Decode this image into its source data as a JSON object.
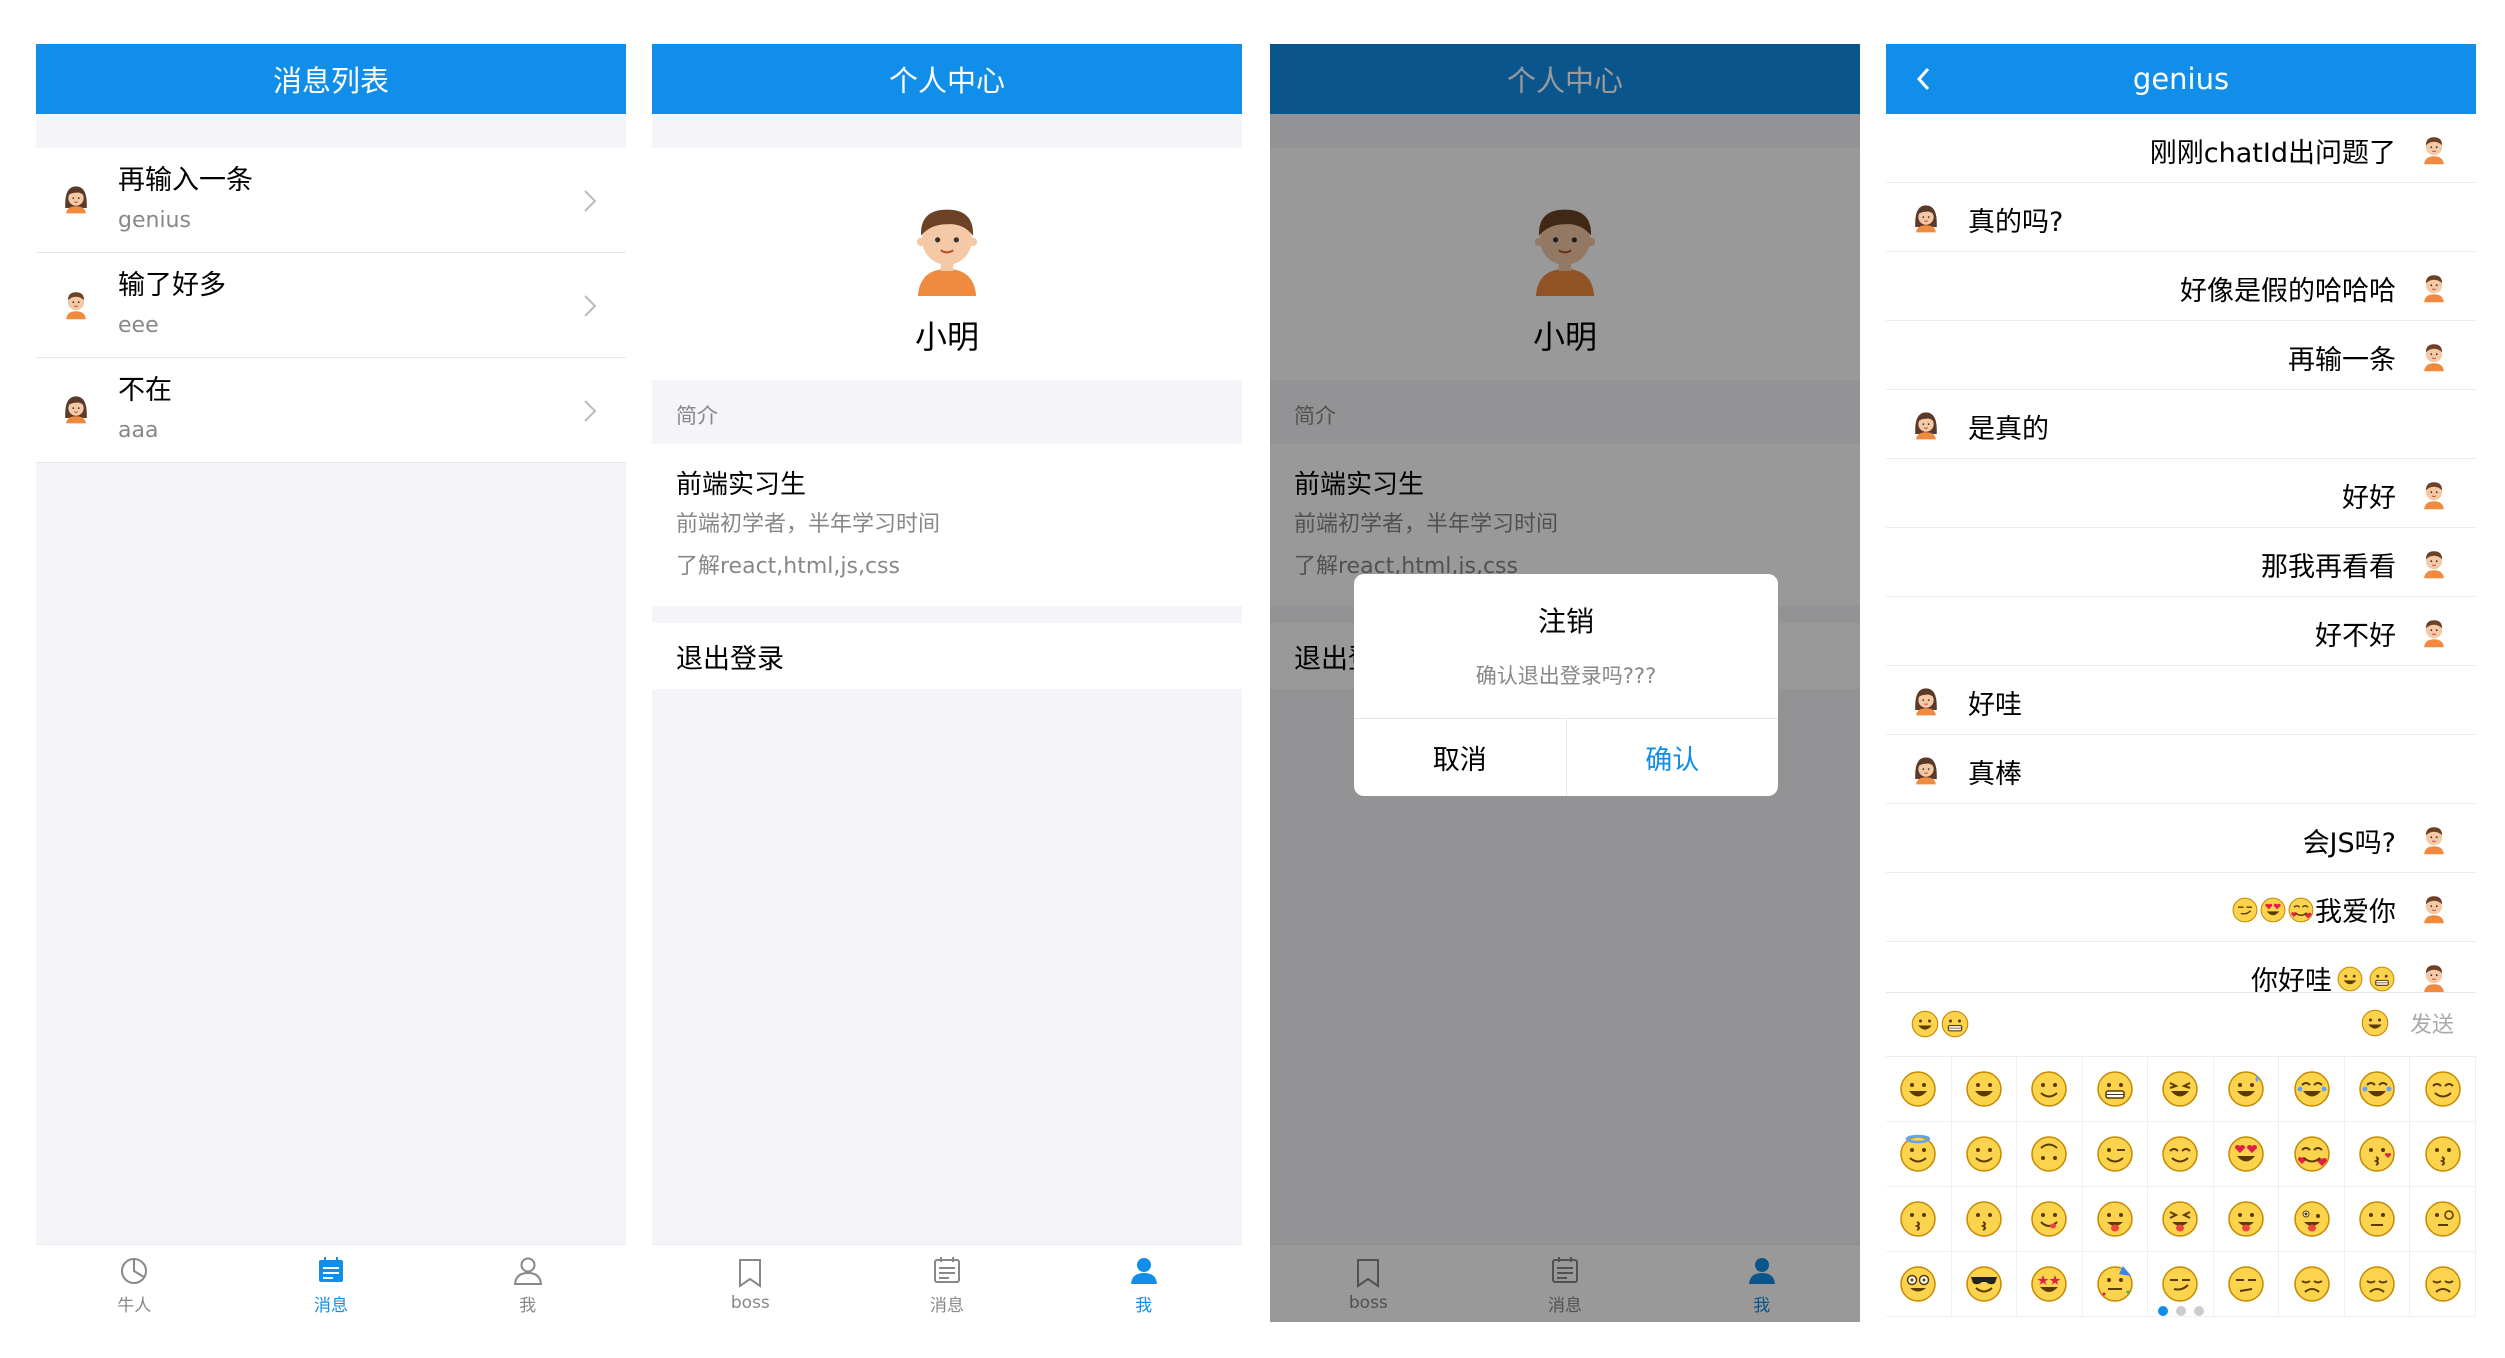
{
  "colors": {
    "primary": "#108ee9",
    "background": "#f5f5f9",
    "muted": "#888888"
  },
  "screen1": {
    "title": "消息列表",
    "messages": [
      {
        "title": "再输入一条",
        "sub": "genius",
        "avatar": "girl-avatar-icon"
      },
      {
        "title": "输了好多",
        "sub": "eee",
        "avatar": "boy-avatar-icon"
      },
      {
        "title": "不在",
        "sub": "aaa",
        "avatar": "girl-avatar-icon"
      }
    ],
    "tabs": [
      {
        "label": "牛人",
        "icon": "pie-chart-icon",
        "active": false
      },
      {
        "label": "消息",
        "icon": "calendar-icon",
        "active": true
      },
      {
        "label": "我",
        "icon": "user-icon",
        "active": false
      }
    ]
  },
  "screen2": {
    "title": "个人中心",
    "name": "小明",
    "section_label": "简介",
    "intro_title": "前端实习生",
    "intro_lines": [
      "前端初学者，半年学习时间",
      "了解react,html,js,css"
    ],
    "logout": "退出登录",
    "tabs": [
      {
        "label": "boss",
        "icon": "bookmark-icon",
        "active": false
      },
      {
        "label": "消息",
        "icon": "calendar-icon",
        "active": false
      },
      {
        "label": "我",
        "icon": "user-icon",
        "active": true
      }
    ]
  },
  "screen3": {
    "title": "个人中心",
    "name": "小明",
    "section_label": "简介",
    "intro_title": "前端实习生",
    "intro_lines": [
      "前端初学者，半年学习时间",
      "了解react,html,js,css"
    ],
    "logout": "退出登录",
    "dialog": {
      "title": "注销",
      "message": "确认退出登录吗???",
      "cancel": "取消",
      "confirm": "确认"
    },
    "tabs": [
      {
        "label": "boss",
        "icon": "bookmark-icon",
        "active": false
      },
      {
        "label": "消息",
        "icon": "calendar-icon",
        "active": false
      },
      {
        "label": "我",
        "icon": "user-icon",
        "active": true
      }
    ]
  },
  "screen4": {
    "title": "genius",
    "back_icon": "chevron-left-icon",
    "messages": [
      {
        "from": "me",
        "text": "刚刚chatId出问题了"
      },
      {
        "from": "other",
        "text": "真的吗?"
      },
      {
        "from": "me",
        "text": "好像是假的哈哈哈"
      },
      {
        "from": "me",
        "text": "再输一条"
      },
      {
        "from": "other",
        "text": "是真的"
      },
      {
        "from": "me",
        "text": "好好"
      },
      {
        "from": "me",
        "text": "那我再看看"
      },
      {
        "from": "me",
        "text": "好不好"
      },
      {
        "from": "other",
        "text": "好哇"
      },
      {
        "from": "other",
        "text": "真棒"
      },
      {
        "from": "me",
        "text": "会JS吗?"
      },
      {
        "from": "me",
        "text": "我爱你",
        "emoji_before": [
          "smirk",
          "heart-eyes",
          "heart-hug"
        ]
      },
      {
        "from": "me",
        "text": "你好哇",
        "emoji_after": [
          "grin",
          "grimace"
        ]
      }
    ],
    "composer_emojis": [
      "grin",
      "grimace"
    ],
    "send_label": "发送",
    "emoji_grid": [
      "grin",
      "grinning",
      "smile",
      "grimace",
      "laugh",
      "sweat-smile",
      "joy",
      "rofl",
      "blush",
      "halo",
      "slight-smile",
      "upside-down",
      "wink",
      "relieved",
      "heart-eyes",
      "heart-hug",
      "kiss",
      "kissing",
      "kiss-smile",
      "kiss-closed",
      "yum",
      "tongue",
      "squint-tongue",
      "wink-tongue",
      "zany",
      "raised-brow",
      "monocle",
      "nerd",
      "cool",
      "star-struck",
      "party",
      "smirk",
      "unamused",
      "disappointed",
      "pensive",
      "worried"
    ],
    "page_dots": 3,
    "page_active": 0
  }
}
